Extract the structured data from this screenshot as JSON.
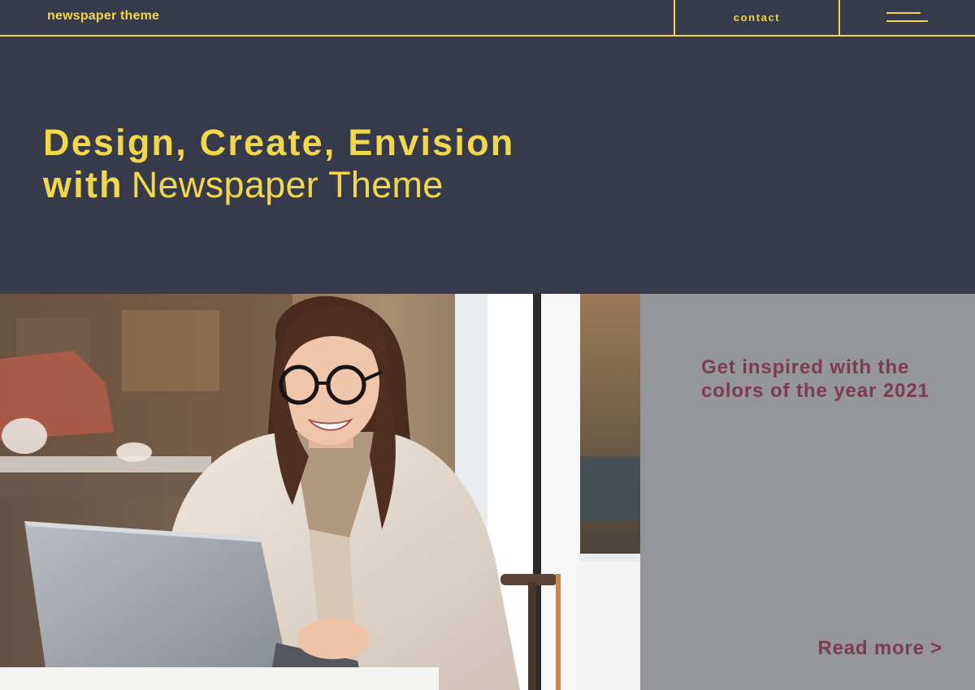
{
  "header": {
    "brand": "newspaper theme",
    "contact": "contact",
    "menu_icon": "hamburger-menu-icon"
  },
  "hero": {
    "line1": "Design, Create, Envision",
    "line2_bold": "with",
    "line2_light": "Newspaper Theme"
  },
  "card": {
    "heading": "Get inspired with the colors of the year 2021",
    "read_more": "Read more >"
  },
  "photo": {
    "subject": "woman-with-laptop-photo"
  },
  "colors": {
    "background": "#373a4b",
    "accent": "#f0d84a",
    "card_bg": "#959699",
    "card_text": "#7d3c4e"
  }
}
